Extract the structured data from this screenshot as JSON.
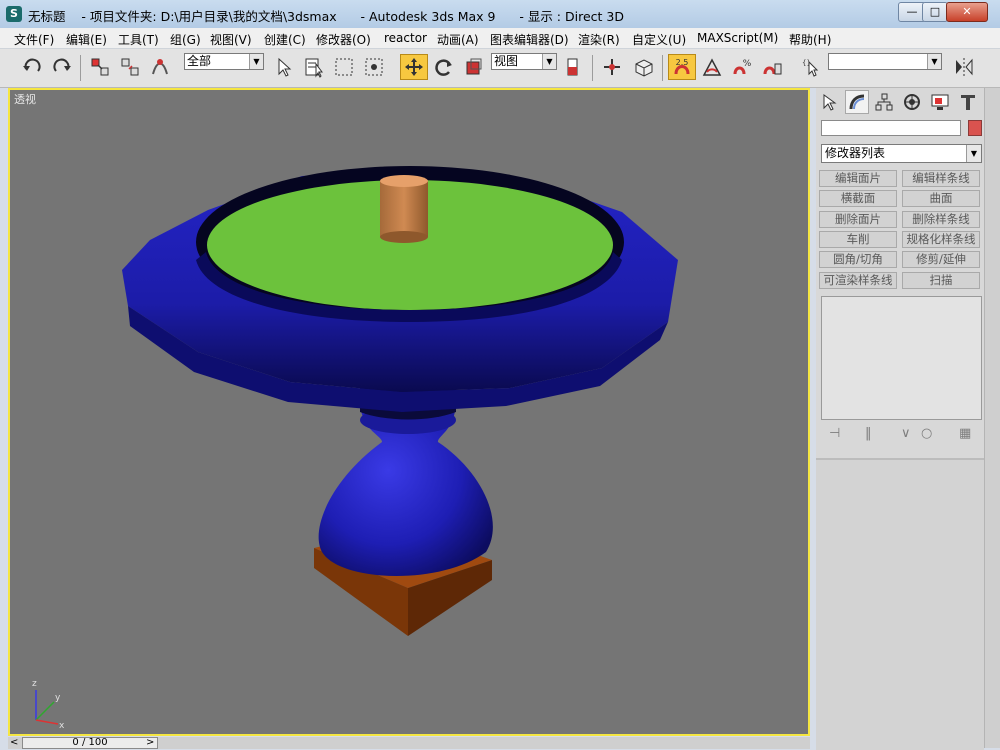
{
  "window": {
    "title": "无标题    - 项目文件夹: D:\\用户目录\\我的文档\\3dsmax      - Autodesk 3ds Max 9      - 显示 : Direct 3D",
    "controls": [
      "minimize",
      "maximize",
      "close"
    ],
    "app_icon_letter": "S"
  },
  "menu": {
    "items": [
      "文件(F)",
      "编辑(E)",
      "工具(T)",
      "组(G)",
      "视图(V)",
      "创建(C)",
      "修改器(O)",
      "reactor",
      "动画(A)",
      "图表编辑器(D)",
      "渲染(R)",
      "自定义(U)",
      "MAXScript(M)",
      "帮助(H)"
    ]
  },
  "toolbar": {
    "selection_filter": "全部",
    "reference_coord": "视图",
    "snap_angle_label": "2.5",
    "named_selection": "",
    "icons": [
      "undo-icon",
      "redo-icon",
      "select-link-icon",
      "unlink-icon",
      "bind-spacewarp-icon",
      "select-object-icon",
      "select-by-name-icon",
      "rect-select-icon",
      "window-crossing-icon",
      "select-move-icon",
      "select-rotate-icon",
      "select-scale-icon",
      "pivot-icon",
      "manipulate-icon",
      "keyboard-shortcut-icon",
      "snap-toggle-icon",
      "angle-snap-icon",
      "percent-snap-icon",
      "spinner-snap-icon",
      "edit-named-selection-icon",
      "mirror-icon"
    ],
    "active_tool": "select-move-icon"
  },
  "viewport": {
    "label": "透视",
    "background": "#757575",
    "active_border": "#f5e641",
    "axis_labels": [
      "z",
      "y",
      "x"
    ]
  },
  "command_panel": {
    "tabs": [
      "create-tab-icon",
      "modify-tab-icon",
      "hierarchy-tab-icon",
      "motion-tab-icon",
      "display-tab-icon",
      "utilities-tab-icon"
    ],
    "active_tab": "modify-tab-icon",
    "object_name": "",
    "object_color": "#d9534f",
    "modifier_list": "修改器列表",
    "modifier_buttons": [
      [
        "编辑面片",
        "编辑样条线"
      ],
      [
        "横截面",
        "曲面"
      ],
      [
        "删除面片",
        "删除样条线"
      ],
      [
        "车削",
        "规格化样条线"
      ],
      [
        "圆角/切角",
        "修剪/延伸"
      ],
      [
        "可渲染样条线",
        "扫描"
      ]
    ],
    "stack_tools": [
      "pin-stack-icon",
      "show-end-result-icon",
      "make-unique-icon",
      "remove-modifier-icon",
      "configure-sets-icon"
    ]
  },
  "time_slider": {
    "frame_display": "0 / 100",
    "prev_label": "<",
    "next_label": ">"
  }
}
